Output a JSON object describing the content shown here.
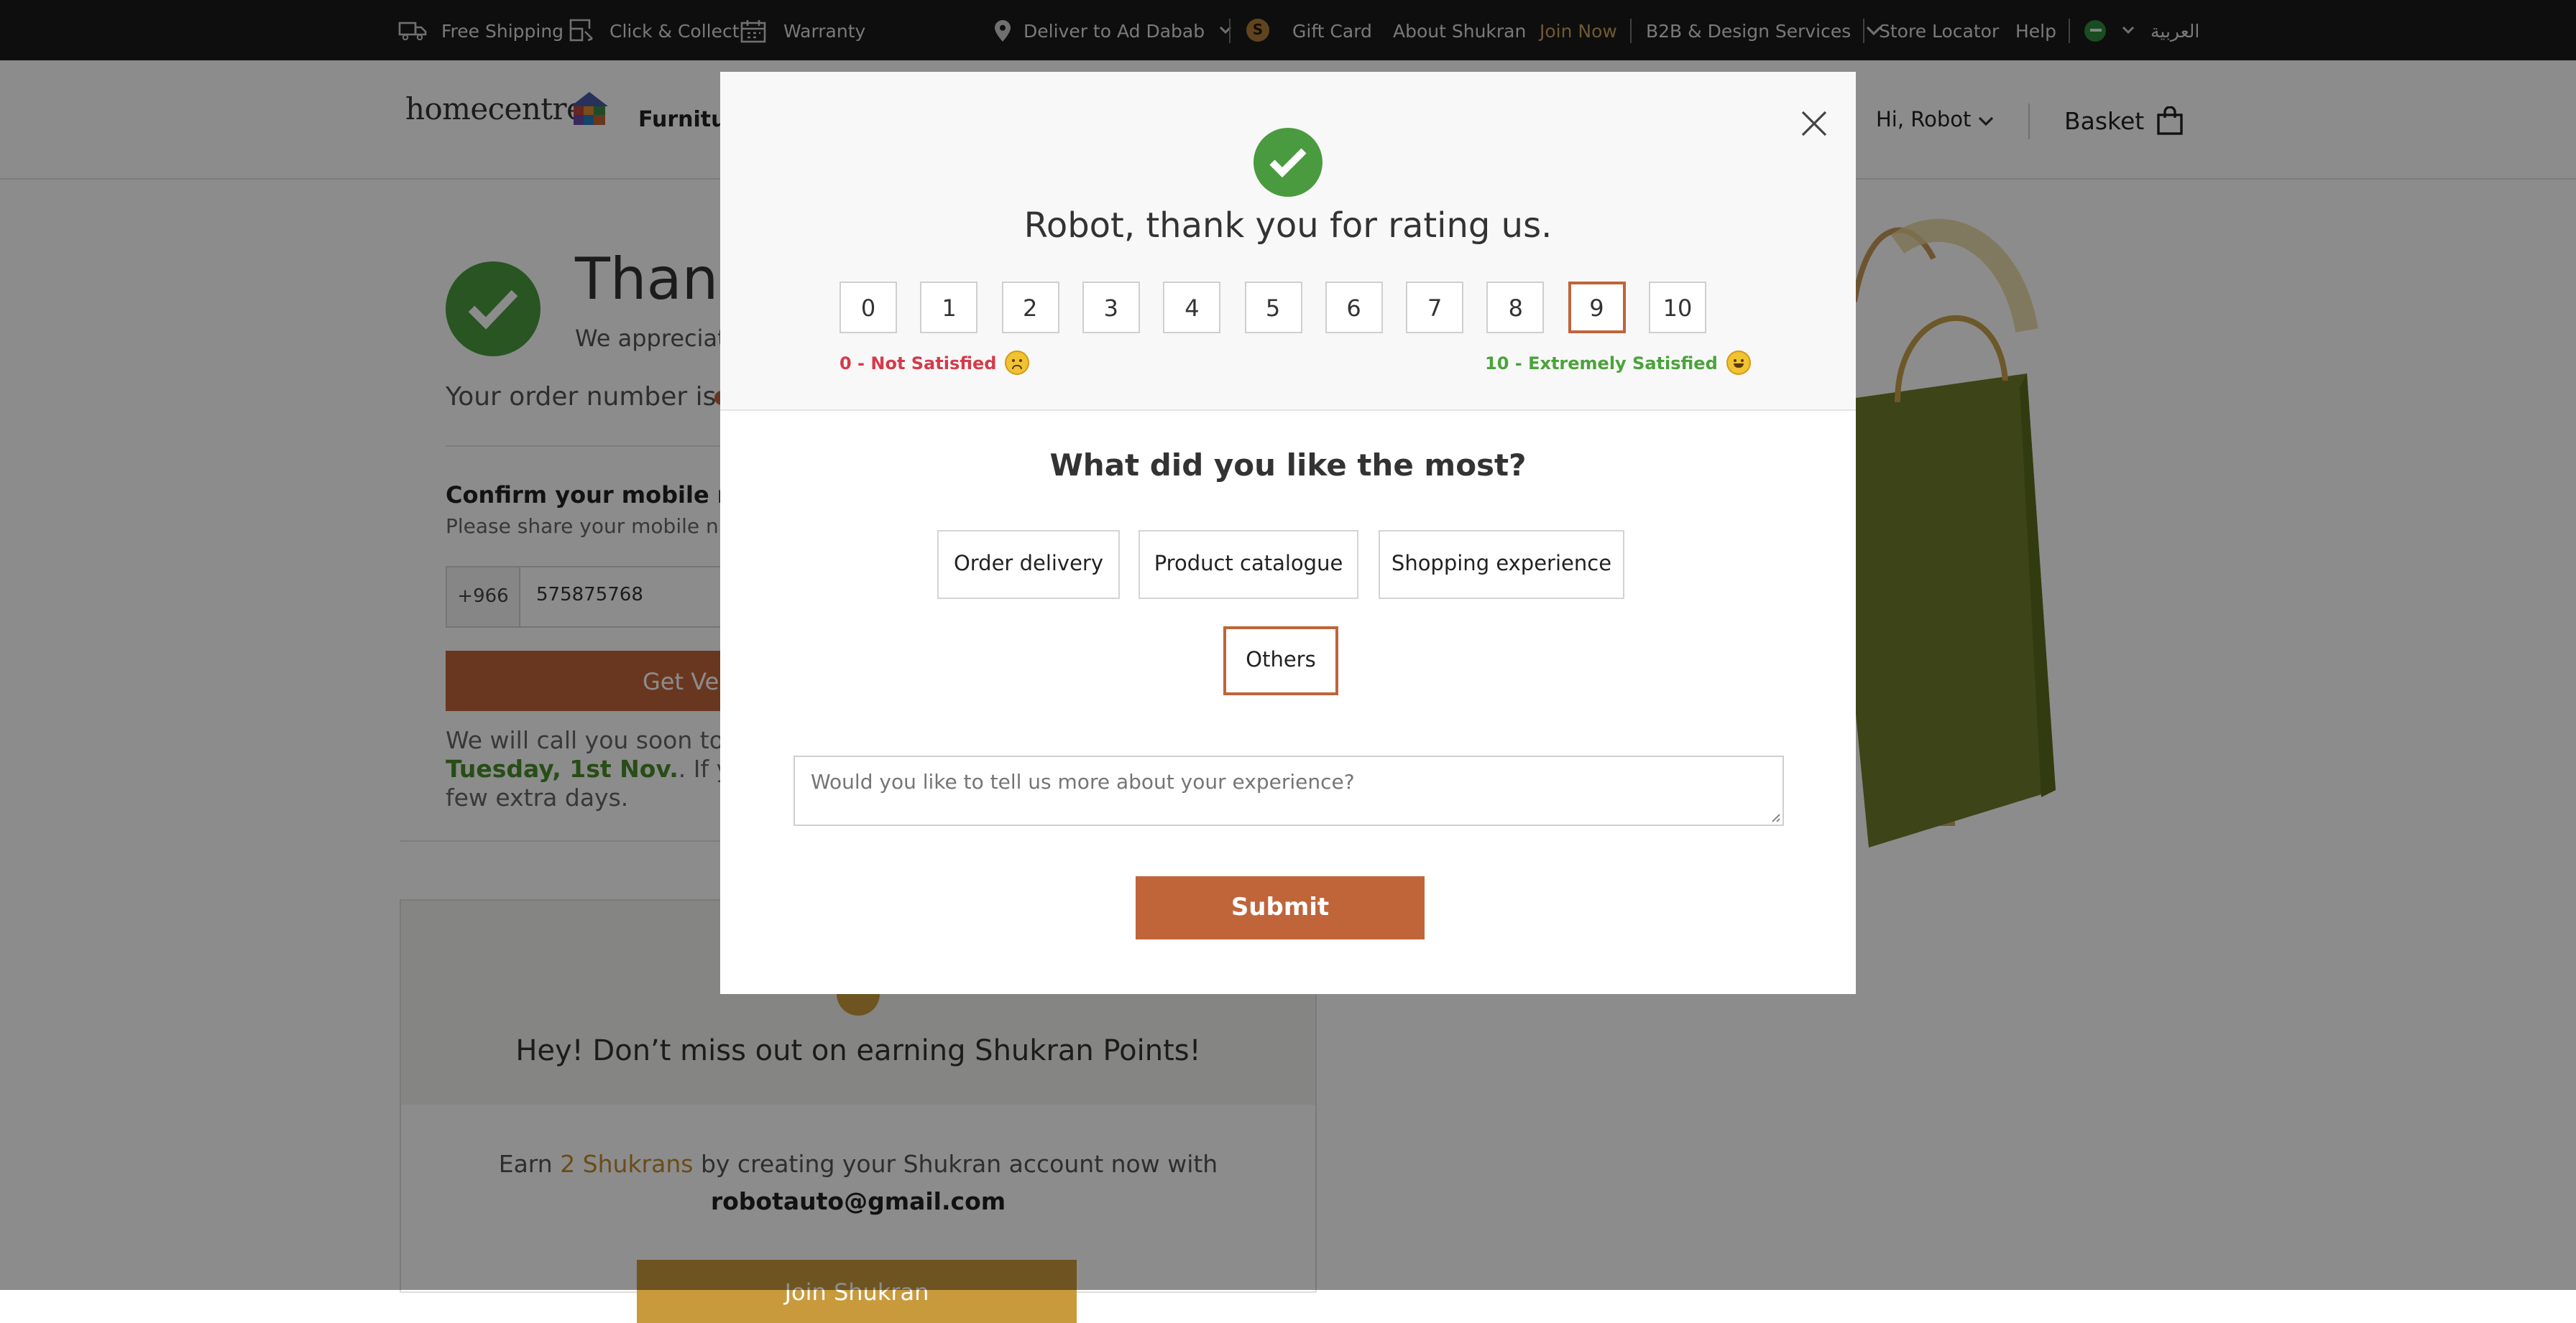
{
  "topbar": {
    "free_shipping": "Free Shipping",
    "click_collect": "Click & Collect",
    "warranty": "Warranty",
    "deliver_to": "Deliver to Ad Dabab",
    "gift_card": "Gift Card",
    "about_shukran": "About Shukran",
    "join_now": "Join Now",
    "b2b": "B2B & Design Services",
    "store_locator": "Store Locator",
    "help": "Help",
    "language": "العربية"
  },
  "header": {
    "logo_text": "homecentre",
    "nav_first": "Furnitur",
    "greeting": "Hi, Robot",
    "basket": "Basket"
  },
  "page": {
    "thank_title": "Thank",
    "thank_sub": "We appreciat",
    "order_prefix": "Your order number is",
    "confirm_title": "Confirm your mobile num",
    "confirm_sub": "Please share your mobile num",
    "phone_code": "+966",
    "phone_value": "575875768",
    "verify_label": "Get Ver",
    "call_text_1": "We will call you soon to c",
    "call_date": "Tuesday, 1st Nov.",
    "call_text_2": ". If your c",
    "call_text_3": "few extra days.",
    "shukran_title": "Hey! Don’t miss out on earning Shukran Points!",
    "earn_prefix": "Earn ",
    "earn_amount": "2 Shukrans",
    "earn_suffix": " by creating your Shukran account now with",
    "email": "robotauto@gmail.com",
    "join_label": "Join Shukran"
  },
  "modal": {
    "title": "Robot, thank you for rating us.",
    "scale": [
      "0",
      "1",
      "2",
      "3",
      "4",
      "5",
      "6",
      "7",
      "8",
      "9",
      "10"
    ],
    "selected_score": "9",
    "label_low": "0 - Not Satisfied",
    "label_high": "10 - Extremely Satisfied",
    "like_title": "What did you like the most?",
    "options": [
      "Order delivery",
      "Product catalogue",
      "Shopping experience",
      "Others"
    ],
    "selected_option": "Others",
    "feedback_placeholder": "Would you like to tell us more about your experience?",
    "submit_label": "Submit"
  },
  "colors": {
    "accent": "#c0643a",
    "success_green": "#4a9b3f",
    "low_red": "#d63a4a",
    "high_green": "#4aa33a",
    "shukran_gold": "#c99a3c"
  },
  "icons": [
    "truck-icon",
    "click-collect-icon",
    "calendar-icon",
    "location-pin-icon",
    "chevron-down-icon",
    "shukran-coin-icon",
    "flag-icon",
    "close-icon",
    "checkmark-icon",
    "basket-icon",
    "sad-face-icon",
    "happy-face-icon"
  ]
}
